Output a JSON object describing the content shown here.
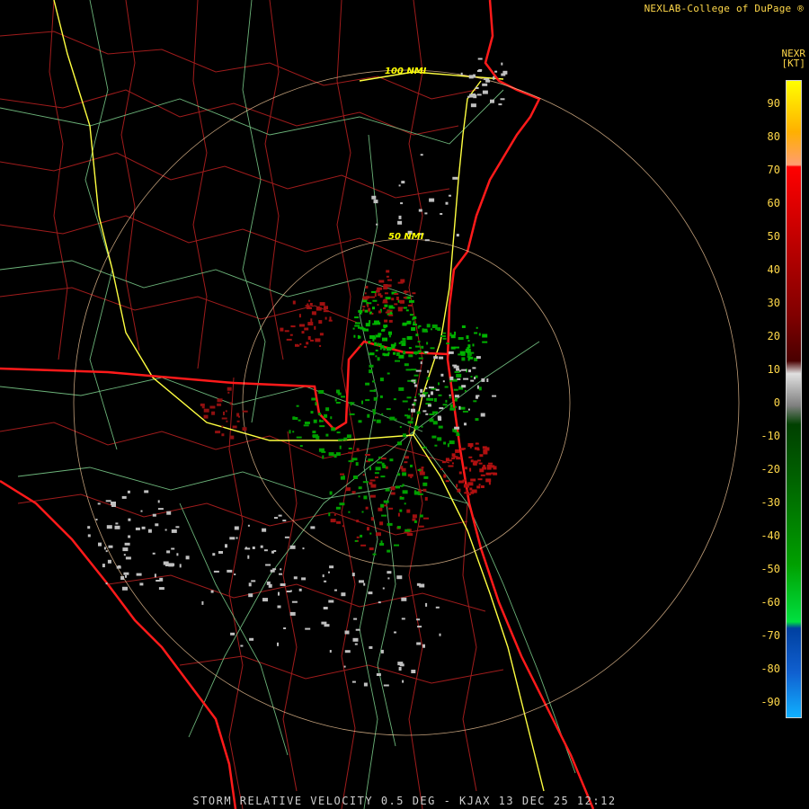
{
  "header": {
    "credit": "NEXLAB-College of DuPage ®"
  },
  "footer": {
    "product_line": "STORM RELATIVE VELOCITY 0.5 DEG - KJAX 13 DEC 25 12:12"
  },
  "map": {
    "ring_labels": [
      "100 NMI",
      "50 NMI"
    ],
    "colors": {
      "background": "#000000",
      "county_lines": "#a01c1c",
      "state_lines": "#ff1a1a",
      "highways": "#7fd38f",
      "interstates": "#ffff40",
      "range_rings": "#ffd2a0"
    }
  },
  "legend": {
    "title": "NEXR",
    "unit": "[KT]",
    "ticks": [
      "90",
      "80",
      "70",
      "60",
      "50",
      "40",
      "30",
      "20",
      "10",
      "0",
      "-10",
      "-20",
      "-30",
      "-40",
      "-50",
      "-60",
      "-70",
      "-80",
      "-90"
    ],
    "colors": {
      "inbound": "#00c800",
      "outbound": "#c00000",
      "near_zero": "#c0c0c0"
    }
  }
}
